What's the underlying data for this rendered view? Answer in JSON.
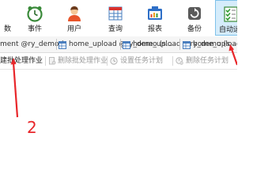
{
  "toolbar": {
    "items": [
      {
        "label": "数",
        "icon": "database-icon"
      },
      {
        "label": "事件",
        "icon": "clock-icon"
      },
      {
        "label": "用户",
        "icon": "user-icon"
      },
      {
        "label": "查询",
        "icon": "table-query-icon"
      },
      {
        "label": "报表",
        "icon": "report-icon"
      },
      {
        "label": "备份",
        "icon": "backup-icon"
      },
      {
        "label": "自动运",
        "icon": "checklist-icon",
        "active": true
      }
    ]
  },
  "tabs": [
    {
      "label": "ment @ry_demo (",
      "icon": ""
    },
    {
      "label": "home_upload @ry_demo (s...",
      "icon": "table-tab-icon"
    },
    {
      "label": "home_upload @ry_demo (s...",
      "icon": "table-tab-icon"
    },
    {
      "label": "home_upload",
      "icon": "table-tab-icon"
    }
  ],
  "actions": {
    "new_batch": "建批处理作业",
    "delete_batch": "删除批处理作业",
    "set_schedule": "设置任务计划",
    "delete_schedule": "删除任务计划"
  },
  "annotation": {
    "number": "2",
    "color": "#e8262a"
  },
  "colors": {
    "active_bg": "#d5ecfb",
    "active_border": "#7fc2ea",
    "disabled_text": "#9a9a9a"
  }
}
